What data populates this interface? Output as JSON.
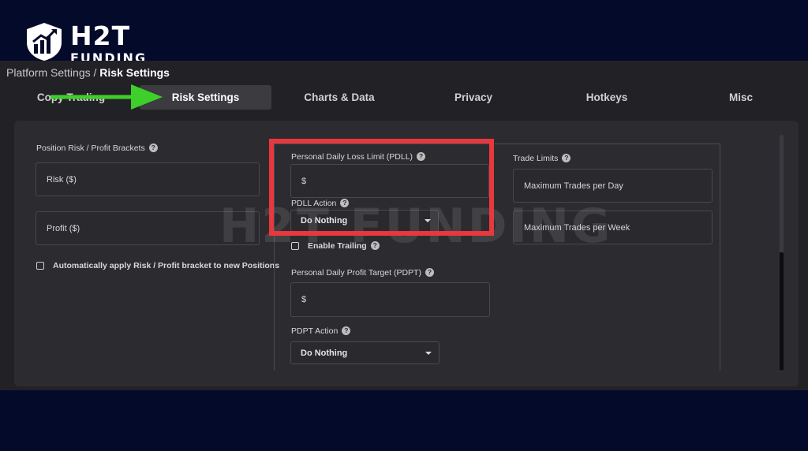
{
  "brand": {
    "name": "H2T",
    "sub": "FUNDING",
    "watermark": "H2T FUNDING"
  },
  "breadcrumb": {
    "parent": "Platform Settings / ",
    "current": "Risk Settings"
  },
  "tabs": [
    {
      "label": "Copy Trading"
    },
    {
      "label": "Risk Settings"
    },
    {
      "label": "Charts & Data"
    },
    {
      "label": "Privacy"
    },
    {
      "label": "Hotkeys"
    },
    {
      "label": "Misc"
    }
  ],
  "position": {
    "heading": "Position Risk / Profit Brackets",
    "risk_placeholder": "Risk ($)",
    "profit_placeholder": "Profit ($)",
    "auto_apply_label": "Automatically apply Risk / Profit bracket to new Positions"
  },
  "pdll": {
    "heading": "Personal Daily Loss Limit (PDLL)",
    "prefix": "$",
    "action_label": "PDLL Action",
    "action_value": "Do Nothing",
    "trailing_label": "Enable Trailing"
  },
  "pdpt": {
    "heading": "Personal Daily Profit Target (PDPT)",
    "prefix": "$",
    "action_label": "PDPT Action",
    "action_value": "Do Nothing"
  },
  "trade_limits": {
    "heading": "Trade Limits",
    "per_day_placeholder": "Maximum Trades per Day",
    "per_week_placeholder": "Maximum Trades per Week"
  },
  "colors": {
    "highlight": "#e8383d",
    "arrow": "#3ecf2a",
    "background": "#040a2a",
    "panel": "#2c2c30"
  }
}
